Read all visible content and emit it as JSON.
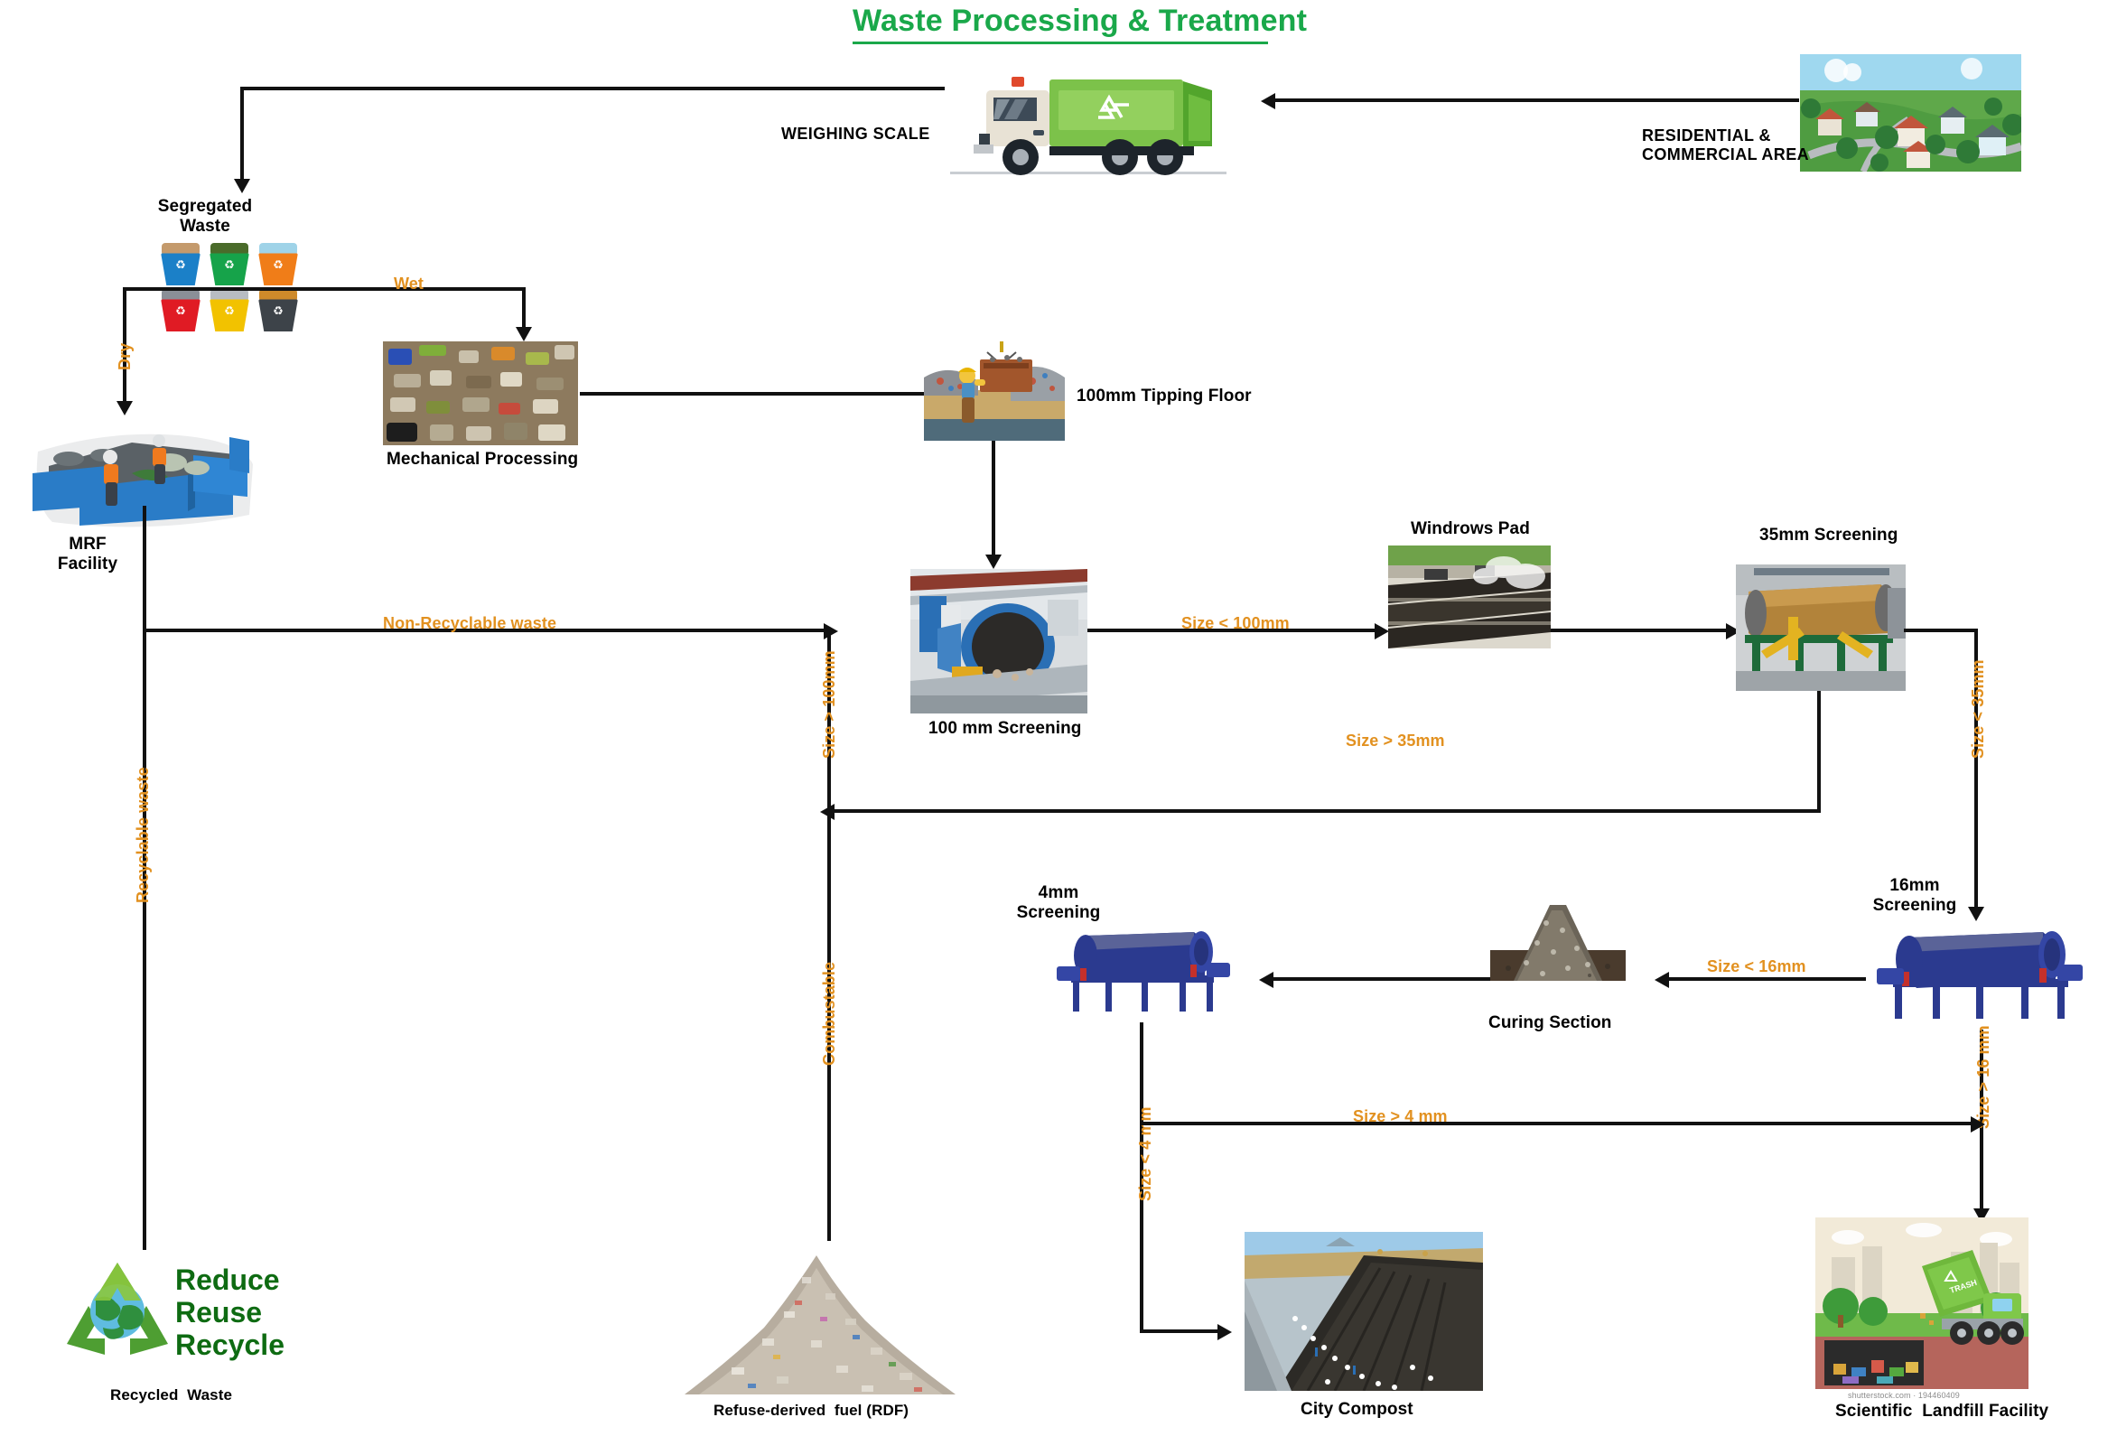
{
  "title": "Waste Processing & Treatment",
  "nodes": {
    "residential": "RESIDENTIAL &\nCOMMERCIAL AREA",
    "weighing_scale": "WEIGHING SCALE",
    "segregated_waste": "Segregated\nWaste",
    "mechanical_processing": "Mechanical Processing",
    "tipping_floor": "100mm Tipping Floor",
    "mrf_facility": "MRF\nFacility",
    "screening_100": "100 mm Screening",
    "windrows_pad": "Windrows Pad",
    "screening_35": "35mm Screening",
    "screening_16": "16mm\nScreening",
    "screening_4": "4mm\nScreening",
    "curing_section": "Curing Section",
    "recycled_waste": "Recycled  Waste",
    "rdf": "Refuse-derived  fuel (RDF)",
    "city_compost": "City Compost",
    "landfill": "Scientific  Landfill Facility"
  },
  "flow_labels": {
    "wet": "Wet",
    "dry": "Dry",
    "non_recyclable": "Non-Recyclable  waste",
    "recyclable": "Recyclable waste",
    "combustable": "Combustable",
    "size_gt_100": "Size > 100mm",
    "size_lt_100": "Size < 100mm",
    "size_gt_35": "Size > 35mm",
    "size_lt_35": "Size < 35mm",
    "size_lt_16": "Size < 16mm",
    "size_gt_16": "Size > 16 mm",
    "size_lt_4": "Size < 4 mm",
    "size_gt_4": "Size > 4 mm"
  },
  "logo": {
    "line1": "Reduce",
    "line2": "Reuse",
    "line3": "Recycle"
  },
  "watermark": "shutterstock.com · 194460409",
  "truck_badge": "TRASH",
  "bins": [
    {
      "name": "paper-bin",
      "color": "#1b80c8",
      "trash": "#c49a6c"
    },
    {
      "name": "glass-bin",
      "color": "#16a34a",
      "trash": "#4a6b2a"
    },
    {
      "name": "plastic-bin",
      "color": "#f07d18",
      "trash": "#9fd3e8"
    },
    {
      "name": "e-waste-bin",
      "color": "#e01b24",
      "trash": "#8a8f97"
    },
    {
      "name": "metal-bin",
      "color": "#f2c200",
      "trash": "#b8bcc2"
    },
    {
      "name": "organic-bin",
      "color": "#3d4349",
      "trash": "#cf8a2a"
    }
  ],
  "colors": {
    "title_green": "#1aa84a",
    "flow_orange": "#e29120",
    "connector_black": "#111111"
  }
}
